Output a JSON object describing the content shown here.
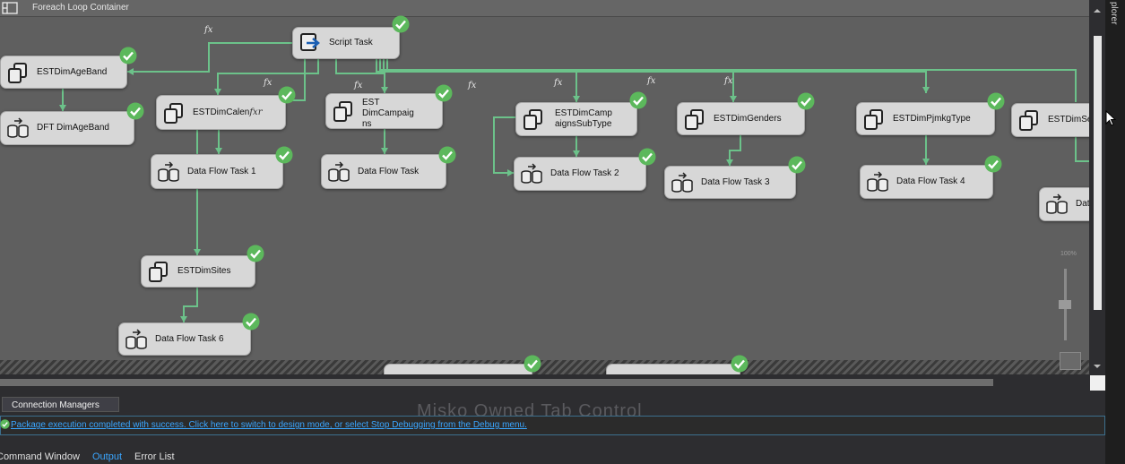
{
  "container": {
    "title": "Foreach Loop Container"
  },
  "tasks": {
    "script_task": "Script Task",
    "est_dim_age_band": "ESTDimAgeBand",
    "dft_dim_age_band": "DFT DimAgeBand",
    "est_dim_calen": "ESTDimCalen",
    "est_dim_calen_fx": "fxr",
    "data_flow_task_1": "Data Flow Task 1",
    "est_dim_campaigns_line1": "EST",
    "est_dim_campaigns_line2": "DimCampaig",
    "est_dim_campaigns_line3": "ns",
    "data_flow_task": "Data Flow Task",
    "est_dim_campaigns_subtype_line1": "ESTDimCamp",
    "est_dim_campaigns_subtype_line2": "aignsSubType",
    "data_flow_task_2": "Data Flow Task 2",
    "est_dim_genders": "ESTDimGenders",
    "data_flow_task_3": "Data Flow Task 3",
    "est_dim_pjmkg_type": "ESTDimPjmkgType",
    "data_flow_task_4": "Data Flow Task 4",
    "est_dim_se": "ESTDimSe",
    "dat": "Dat",
    "est_dim_sites": "ESTDimSites",
    "data_flow_task_6": "Data Flow Task 6"
  },
  "fx_label": "fx",
  "zoom_label": "100%",
  "tabs": {
    "connection_managers": "Connection Managers"
  },
  "ghost_text": "Misko Owned Tab Control",
  "status": {
    "message": "Package execution completed with success. Click here to switch to design mode, or select Stop Debugging from the Debug menu."
  },
  "bottom_tabs": {
    "command_window": "Command Window",
    "output": "Output",
    "error_list": "Error List"
  },
  "side_panel": {
    "label": "plorer"
  },
  "colors": {
    "canvas": "#5f5f5f",
    "connector": "#6cc28a",
    "check": "#5cb85c",
    "link": "#3aa6ff"
  }
}
